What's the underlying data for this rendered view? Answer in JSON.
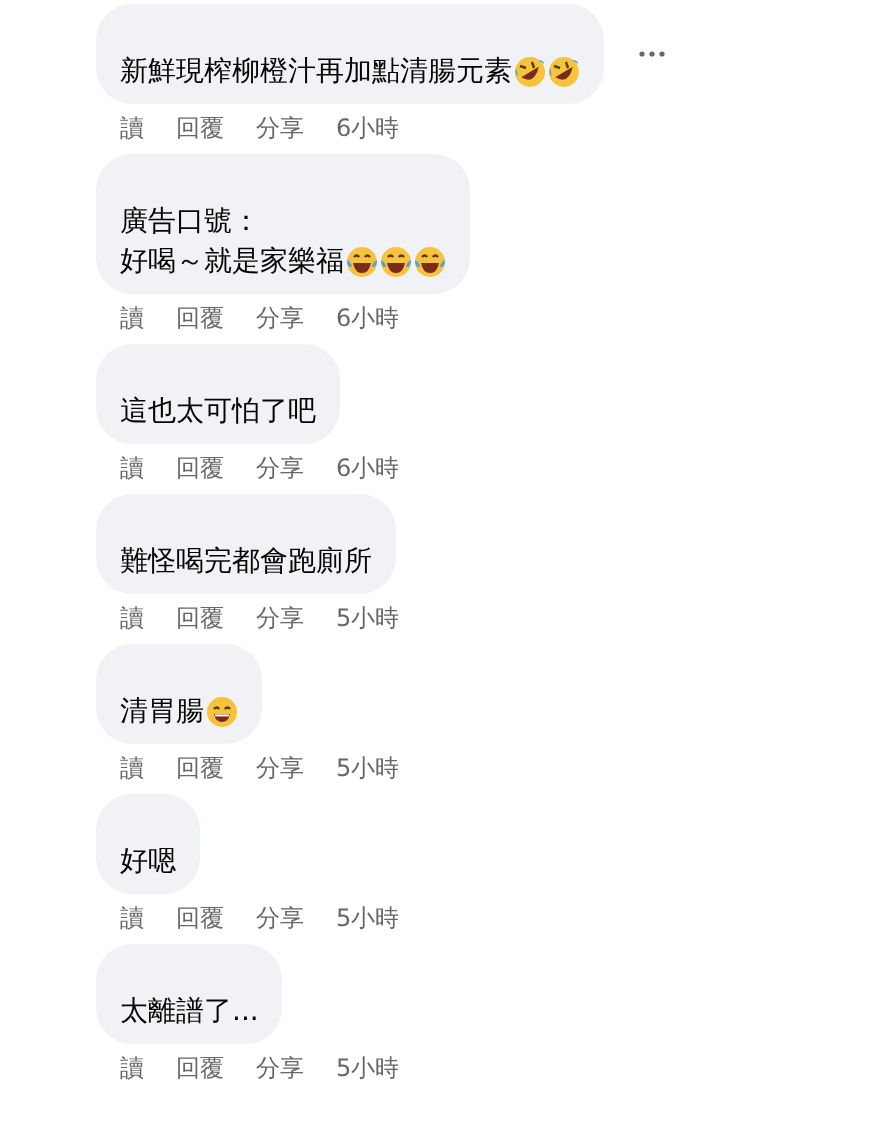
{
  "comments": [
    {
      "lines": [
        "新鮮現榨柳橙汁再加點清腸元素"
      ],
      "emojis": [
        {
          "kind": "rofl"
        },
        {
          "kind": "rofl"
        }
      ],
      "show_more": true,
      "actions": [
        "讀",
        "回覆",
        "分享"
      ],
      "time": "6小時"
    },
    {
      "lines": [
        "廣告口號：",
        "好喝～就是家樂福"
      ],
      "emojis": [
        {
          "kind": "joy"
        },
        {
          "kind": "joy"
        },
        {
          "kind": "joy"
        }
      ],
      "show_more": false,
      "actions": [
        "讀",
        "回覆",
        "分享"
      ],
      "time": "6小時"
    },
    {
      "lines": [
        "這也太可怕了吧"
      ],
      "show_more": false,
      "actions": [
        "讀",
        "回覆",
        "分享"
      ],
      "time": "6小時"
    },
    {
      "lines": [
        "難怪喝完都會跑廁所"
      ],
      "show_more": false,
      "actions": [
        "讀",
        "回覆",
        "分享"
      ],
      "time": "5小時"
    },
    {
      "lines": [
        "清胃腸"
      ],
      "emojis": [
        {
          "kind": "grin"
        }
      ],
      "show_more": false,
      "actions": [
        "讀",
        "回覆",
        "分享"
      ],
      "time": "5小時"
    },
    {
      "lines": [
        "好嗯"
      ],
      "show_more": false,
      "actions": [
        "讀",
        "回覆",
        "分享"
      ],
      "time": "5小時"
    },
    {
      "lines": [
        "太離譜了..."
      ],
      "show_more": false,
      "actions": [
        "讀",
        "回覆",
        "分享"
      ],
      "time": "5小時"
    }
  ]
}
